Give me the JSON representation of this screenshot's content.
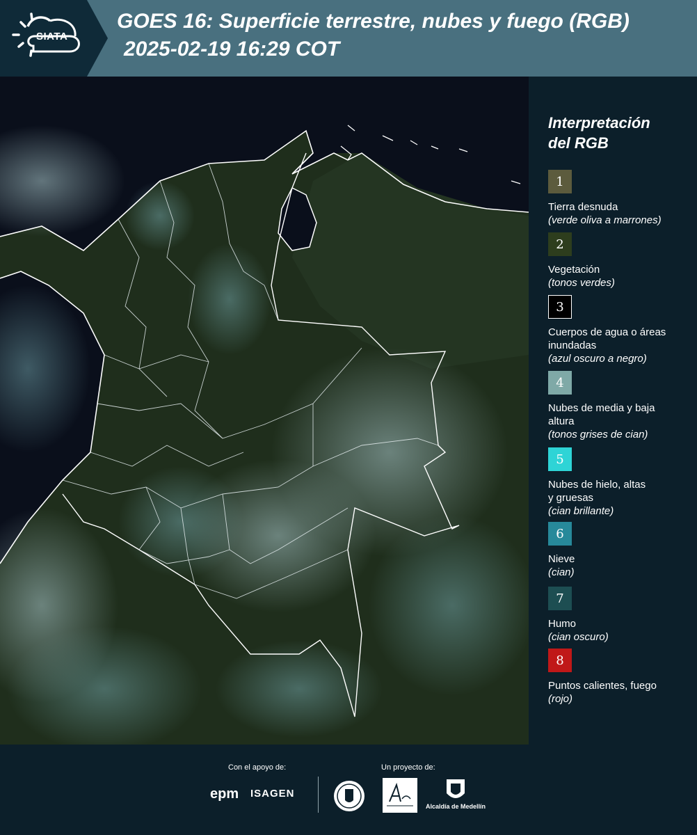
{
  "header": {
    "logo_text": "SIATA",
    "title_line1": "GOES 16: Superficie terrestre, nubes y fuego (RGB)",
    "title_line2": "2025-02-19 16:29 COT"
  },
  "legend": {
    "title_line1": "Interpretación",
    "title_line2": "del RGB",
    "items": [
      {
        "num": "1",
        "color": "#5c5b3d",
        "label": "Tierra desnuda",
        "sub": "(verde oliva a marrones)"
      },
      {
        "num": "2",
        "color": "#2d3d1d",
        "label": "Vegetación",
        "sub": "(tonos verdes)"
      },
      {
        "num": "3",
        "color": "#000000",
        "label": "Cuerpos de agua o áreas inundadas",
        "sub": "(azul oscuro a negro)"
      },
      {
        "num": "4",
        "color": "#7fa9a7",
        "label": "Nubes de media y baja altura",
        "sub": "(tonos grises de cian)"
      },
      {
        "num": "5",
        "color": "#2ed4d6",
        "label": "Nubes de hielo, altas y gruesas",
        "sub": "(cian brillante)"
      },
      {
        "num": "6",
        "color": "#27899a",
        "label": "Nieve",
        "sub": "(cian)"
      },
      {
        "num": "7",
        "color": "#1d4e52",
        "label": "Humo",
        "sub": "(cian oscuro)"
      },
      {
        "num": "8",
        "color": "#c01818",
        "label": "Puntos calientes, fuego",
        "sub": "(rojo)"
      }
    ]
  },
  "footer": {
    "support_label": "Con el apoyo de:",
    "project_label": "Un proyecto de:",
    "sponsor_1": "epm",
    "sponsor_2": "ISAGEN",
    "partner_1": "Área Metropolitana",
    "partner_2": "Alcaldía de Medellín"
  }
}
